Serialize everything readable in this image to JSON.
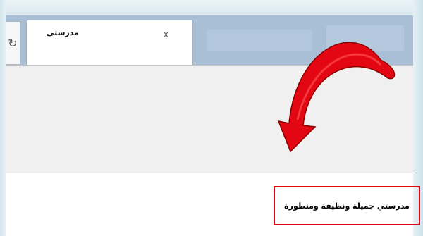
{
  "browser": {
    "tab_title": "مدرستي",
    "tab_close_glyph": "x",
    "refresh_icon": "refresh-icon",
    "refresh_glyph": "↻"
  },
  "content": {
    "typed_text": "مدرستي جميلة ونظيفة ومتطورة"
  },
  "annotation": {
    "arrow_icon": "curved-arrow-icon",
    "arrow_color": "#e30613",
    "highlight_color": "#e30613"
  }
}
